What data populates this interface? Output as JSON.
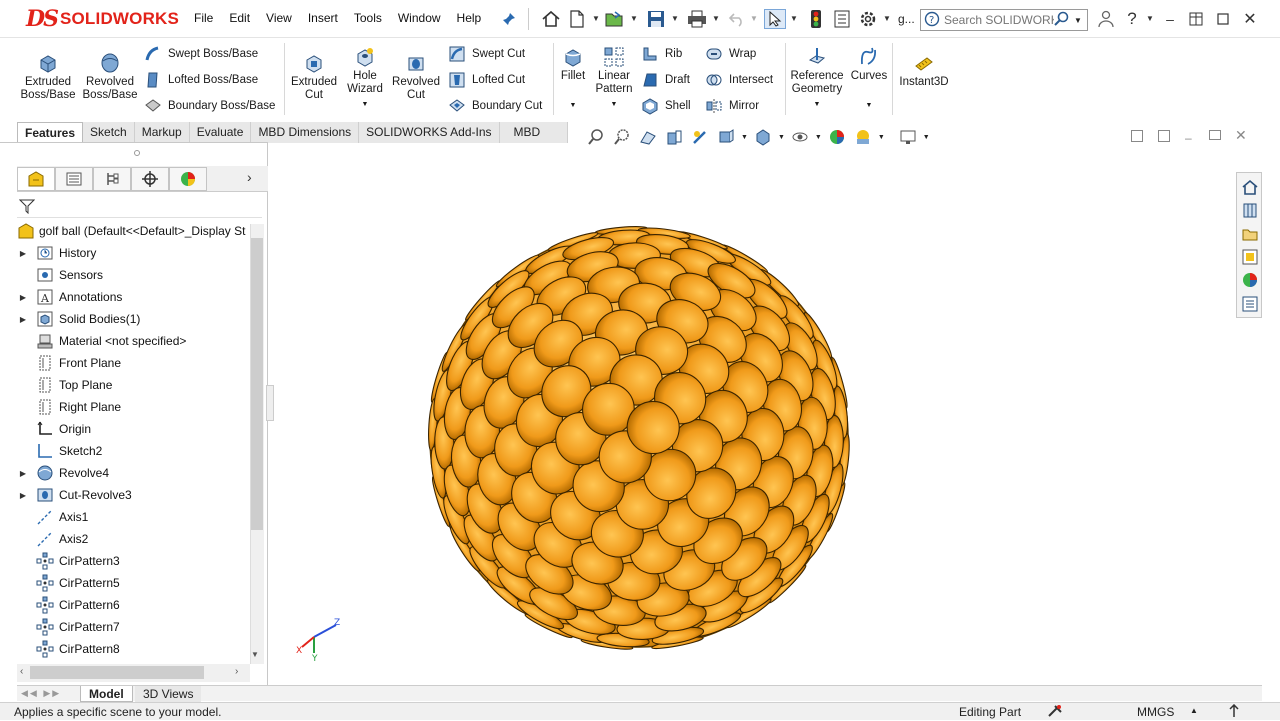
{
  "app": {
    "logo_mark": "DS",
    "logo_text": "SOLIDWORKS",
    "doc_title_short": "g..."
  },
  "menu": [
    "File",
    "Edit",
    "View",
    "Insert",
    "Tools",
    "Window",
    "Help"
  ],
  "search": {
    "placeholder": "Search SOLIDWORKS"
  },
  "ribbon": {
    "extruded_boss": [
      "Extruded",
      "Boss/Base"
    ],
    "revolved_boss": [
      "Revolved",
      "Boss/Base"
    ],
    "swept_boss": "Swept Boss/Base",
    "lofted_boss": "Lofted Boss/Base",
    "boundary_boss": "Boundary Boss/Base",
    "extruded_cut": [
      "Extruded",
      "Cut"
    ],
    "hole_wizard": [
      "Hole",
      "Wizard"
    ],
    "revolved_cut": [
      "Revolved",
      "Cut"
    ],
    "swept_cut": "Swept Cut",
    "lofted_cut": "Lofted Cut",
    "boundary_cut": "Boundary Cut",
    "fillet": "Fillet",
    "linear_pattern": [
      "Linear",
      "Pattern"
    ],
    "rib": "Rib",
    "draft": "Draft",
    "shell": "Shell",
    "wrap": "Wrap",
    "intersect": "Intersect",
    "mirror": "Mirror",
    "reference_geometry": [
      "Reference",
      "Geometry"
    ],
    "curves": "Curves",
    "instant3d": "Instant3D"
  },
  "tabs": [
    "Features",
    "Sketch",
    "Markup",
    "Evaluate",
    "MBD Dimensions",
    "SOLIDWORKS Add-Ins",
    "MBD"
  ],
  "tree": {
    "root": "golf ball  (Default<<Default>_Display St",
    "items": [
      {
        "label": "History",
        "expandable": true,
        "icon": "history-icon"
      },
      {
        "label": "Sensors",
        "expandable": false,
        "icon": "sensor-icon"
      },
      {
        "label": "Annotations",
        "expandable": true,
        "icon": "annotation-icon"
      },
      {
        "label": "Solid Bodies(1)",
        "expandable": true,
        "icon": "solid-body-icon"
      },
      {
        "label": "Material <not specified>",
        "expandable": false,
        "icon": "material-icon"
      },
      {
        "label": "Front Plane",
        "expandable": false,
        "icon": "plane-icon"
      },
      {
        "label": "Top Plane",
        "expandable": false,
        "icon": "plane-icon"
      },
      {
        "label": "Right Plane",
        "expandable": false,
        "icon": "plane-icon"
      },
      {
        "label": "Origin",
        "expandable": false,
        "icon": "origin-icon"
      },
      {
        "label": "Sketch2",
        "expandable": false,
        "icon": "sketch-icon"
      },
      {
        "label": "Revolve4",
        "expandable": true,
        "icon": "revolve-icon"
      },
      {
        "label": "Cut-Revolve3",
        "expandable": true,
        "icon": "cut-revolve-icon"
      },
      {
        "label": "Axis1",
        "expandable": false,
        "icon": "axis-icon"
      },
      {
        "label": "Axis2",
        "expandable": false,
        "icon": "axis-icon"
      },
      {
        "label": "CirPattern3",
        "expandable": false,
        "icon": "circular-pattern-icon"
      },
      {
        "label": "CirPattern5",
        "expandable": false,
        "icon": "circular-pattern-icon"
      },
      {
        "label": "CirPattern6",
        "expandable": false,
        "icon": "circular-pattern-icon"
      },
      {
        "label": "CirPattern7",
        "expandable": false,
        "icon": "circular-pattern-icon"
      },
      {
        "label": "CirPattern8",
        "expandable": false,
        "icon": "circular-pattern-icon"
      }
    ]
  },
  "bottom_tabs": {
    "model": "Model",
    "views3d": "3D Views"
  },
  "status": {
    "message": "Applies a specific scene to your model.",
    "mode": "Editing Part",
    "units": "MMGS"
  },
  "triad": {
    "z_label": "Z",
    "y_label": "Y",
    "x_label": "X"
  },
  "colors": {
    "ball": "#f0a020",
    "ball_shade": "#b86a00",
    "accent_red": "#e2231a",
    "icon_blue": "#2a6ab0"
  }
}
